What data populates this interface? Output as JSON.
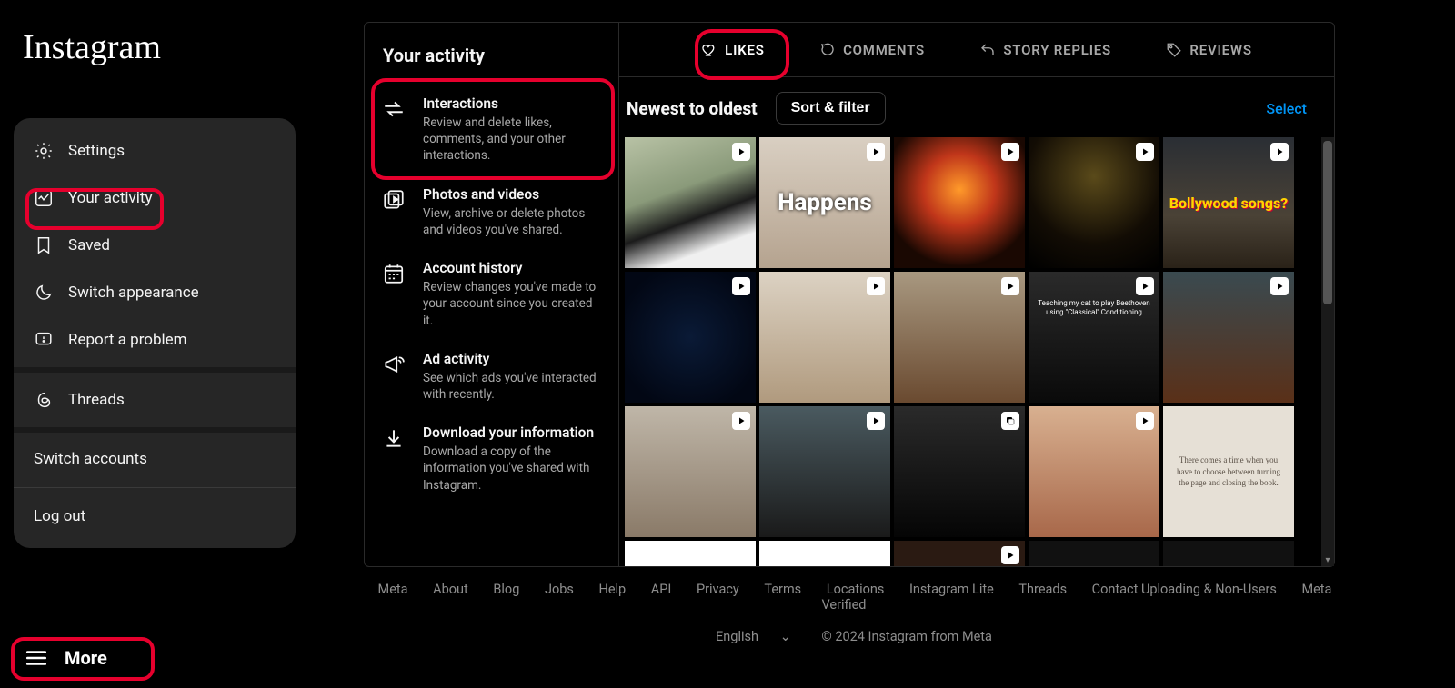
{
  "brand": "Instagram",
  "popup": {
    "settings": "Settings",
    "your_activity": "Your activity",
    "saved": "Saved",
    "switch_appearance": "Switch appearance",
    "report": "Report a problem",
    "threads": "Threads",
    "switch_accounts": "Switch accounts",
    "logout": "Log out"
  },
  "more_button": "More",
  "activity": {
    "title": "Your activity",
    "items": [
      {
        "title": "Interactions",
        "desc": "Review and delete likes, comments, and your other interactions."
      },
      {
        "title": "Photos and videos",
        "desc": "View, archive or delete photos and videos you've shared."
      },
      {
        "title": "Account history",
        "desc": "Review changes you've made to your account since you created it."
      },
      {
        "title": "Ad activity",
        "desc": "See which ads you've interacted with recently."
      },
      {
        "title": "Download your information",
        "desc": "Download a copy of the information you've shared with Instagram."
      }
    ]
  },
  "tabs": {
    "likes": "LIKES",
    "comments": "COMMENTS",
    "story_replies": "STORY REPLIES",
    "reviews": "REVIEWS"
  },
  "toolbar": {
    "sort_order": "Newest to oldest",
    "sort_filter": "Sort & filter",
    "select": "Select"
  },
  "thumb_text": {
    "happens": "Happens",
    "bollywood": "Bollywood songs?",
    "cat": "Teaching my cat to play Beethoven using \"Classical\" Conditioning",
    "quote": "There comes a time when you have to choose between turning the page and closing the book."
  },
  "footer": {
    "links": [
      "Meta",
      "About",
      "Blog",
      "Jobs",
      "Help",
      "API",
      "Privacy",
      "Terms",
      "Locations",
      "Instagram Lite",
      "Threads",
      "Contact Uploading & Non-Users",
      "Meta Verified"
    ],
    "language": "English",
    "copyright": "© 2024 Instagram from Meta"
  }
}
